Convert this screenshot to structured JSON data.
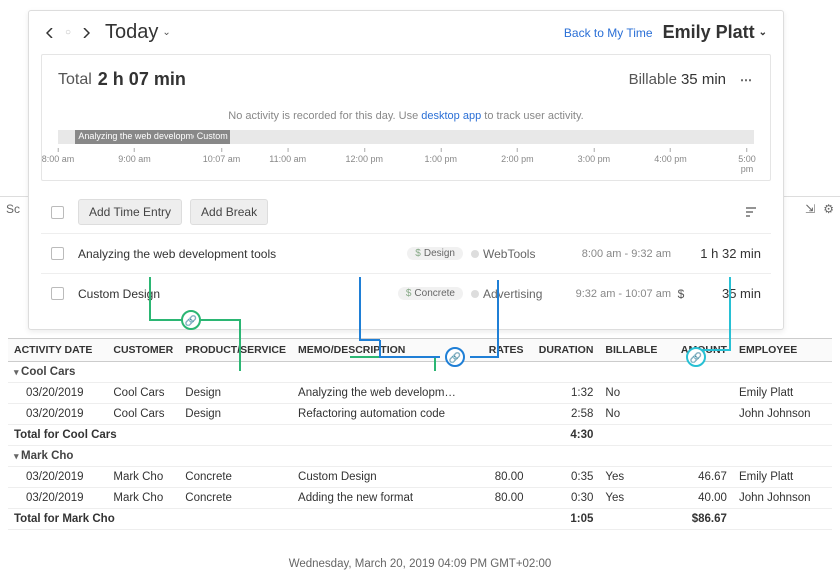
{
  "header": {
    "title": "Today",
    "back_link": "Back to My Time",
    "user": "Emily Platt"
  },
  "summary": {
    "total_label": "Total",
    "total_value": "2 h 07 min",
    "billable_label": "Billable",
    "billable_value": "35 min"
  },
  "info": {
    "prefix": "No activity is recorded for this day. Use ",
    "link": "desktop app",
    "suffix": " to track user activity."
  },
  "timeline": {
    "ticks": [
      "8:00 am",
      "9:00 am",
      "10:07 am",
      "11:00 am",
      "12:00 pm",
      "1:00 pm",
      "2:00 pm",
      "3:00 pm",
      "4:00 pm",
      "5:00 pm"
    ],
    "seg1": "Analyzing the web development",
    "seg2": "Custom De"
  },
  "toolbar": {
    "add_time": "Add Time Entry",
    "add_break": "Add Break"
  },
  "entries": [
    {
      "title": "Analyzing the web development tools",
      "tag": "Design",
      "project": "WebTools",
      "range": "8:00 am - 9:32 am",
      "dollar": "",
      "duration": "1 h 32 min"
    },
    {
      "title": "Custom Design",
      "tag": "Concrete",
      "project": "Advertising",
      "range": "9:32 am - 10:07 am",
      "dollar": "$",
      "duration": "35 min"
    }
  ],
  "back_strip": {
    "left": "Sc"
  },
  "table": {
    "headers": [
      "ACTIVITY DATE",
      "CUSTOMER",
      "PRODUCT/SERVICE",
      "MEMO/DESCRIPTION",
      "RATES",
      "DURATION",
      "BILLABLE",
      "AMOUNT",
      "EMPLOYEE"
    ],
    "groups": [
      {
        "name": "Cool Cars",
        "rows": [
          {
            "date": "03/20/2019",
            "customer": "Cool Cars",
            "product": "Design",
            "memo": "Analyzing the web developm…",
            "rate": "",
            "duration": "1:32",
            "billable": "No",
            "amount": "",
            "employee": "Emily Platt"
          },
          {
            "date": "03/20/2019",
            "customer": "Cool Cars",
            "product": "Design",
            "memo": "Refactoring automation code",
            "rate": "",
            "duration": "2:58",
            "billable": "No",
            "amount": "",
            "employee": "John Johnson"
          }
        ],
        "total_label": "Total for Cool Cars",
        "total_duration": "4:30",
        "total_amount": ""
      },
      {
        "name": "Mark Cho",
        "rows": [
          {
            "date": "03/20/2019",
            "customer": "Mark Cho",
            "product": "Concrete",
            "memo": "Custom Design",
            "rate": "80.00",
            "duration": "0:35",
            "billable": "Yes",
            "amount": "46.67",
            "employee": "Emily Platt"
          },
          {
            "date": "03/20/2019",
            "customer": "Mark Cho",
            "product": "Concrete",
            "memo": "Adding the new format",
            "rate": "80.00",
            "duration": "0:30",
            "billable": "Yes",
            "amount": "40.00",
            "employee": "John Johnson"
          }
        ],
        "total_label": "Total for Mark Cho",
        "total_duration": "1:05",
        "total_amount": "$86.67"
      }
    ]
  },
  "footer": "Wednesday, March 20, 2019   04:09 PM GMT+02:00",
  "colors": {
    "green": "#2bb673",
    "blue": "#1f7fd6",
    "cyan": "#27c0d4"
  }
}
